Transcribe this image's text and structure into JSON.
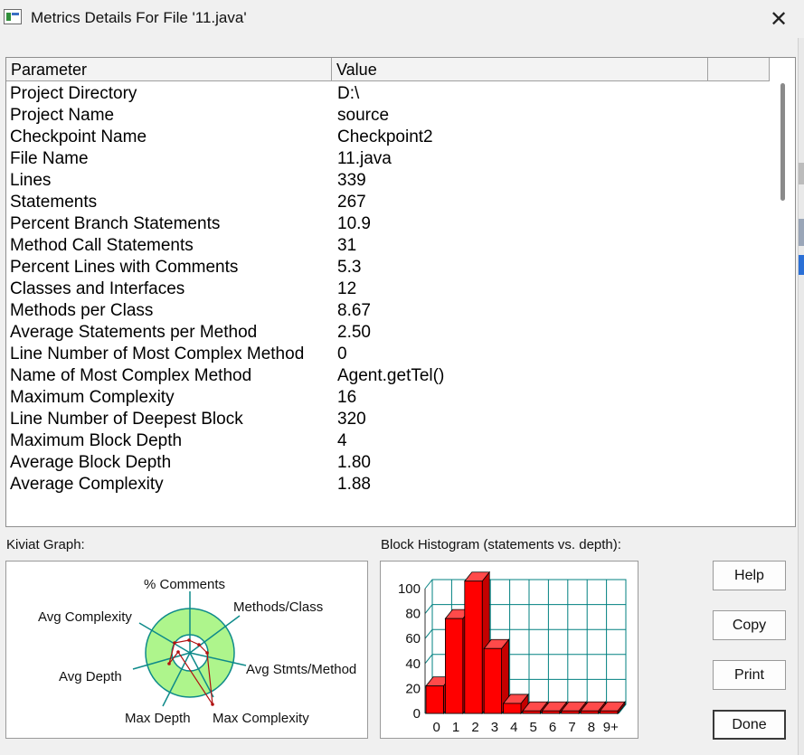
{
  "window": {
    "title": "Metrics Details For File '11.java'",
    "close_glyph": "✕"
  },
  "table": {
    "columns": [
      "Parameter",
      "Value",
      ""
    ],
    "rows": [
      [
        "Project Directory",
        "D:\\"
      ],
      [
        "Project Name",
        "source"
      ],
      [
        "Checkpoint Name",
        "Checkpoint2"
      ],
      [
        "File Name",
        "11.java"
      ],
      [
        "Lines",
        "339"
      ],
      [
        "Statements",
        "267"
      ],
      [
        "Percent Branch Statements",
        "10.9"
      ],
      [
        "Method Call Statements",
        "31"
      ],
      [
        "Percent Lines with Comments",
        "5.3"
      ],
      [
        "Classes and Interfaces",
        "12"
      ],
      [
        "Methods per Class",
        "8.67"
      ],
      [
        "Average Statements per Method",
        "2.50"
      ],
      [
        "Line Number of Most Complex Method",
        "0"
      ],
      [
        "Name of Most Complex Method",
        "Agent.getTel()"
      ],
      [
        "Maximum Complexity",
        "16"
      ],
      [
        "Line Number of Deepest Block",
        "320"
      ],
      [
        "Maximum Block Depth",
        "4"
      ],
      [
        "Average Block Depth",
        "1.80"
      ],
      [
        "Average Complexity",
        "1.88"
      ]
    ]
  },
  "kiviat": {
    "label": "Kiviat Graph:",
    "axes": [
      "% Comments",
      "Methods/Class",
      "Avg Stmts/Method",
      "Max Complexity",
      "Max Depth",
      "Avg Depth",
      "Avg Complexity"
    ]
  },
  "histogram": {
    "label": "Block Histogram (statements vs. depth):"
  },
  "buttons": {
    "help": "Help",
    "copy": "Copy",
    "print": "Print",
    "done": "Done"
  },
  "colors": {
    "bar": "#ff0000",
    "grid": "#008080",
    "ring": "#aef58c",
    "axis": "#0e8a8a",
    "kiviat_line": "#b01010"
  },
  "chart_data": {
    "type": "bar",
    "categories": [
      "0",
      "1",
      "2",
      "3",
      "4",
      "5",
      "6",
      "7",
      "8",
      "9+"
    ],
    "values": [
      22,
      76,
      106,
      52,
      8,
      2,
      2,
      2,
      2,
      2
    ],
    "ylim": [
      0,
      100
    ],
    "yticks": [
      0,
      20,
      40,
      60,
      80,
      100
    ],
    "grid": true,
    "style": "3d"
  }
}
